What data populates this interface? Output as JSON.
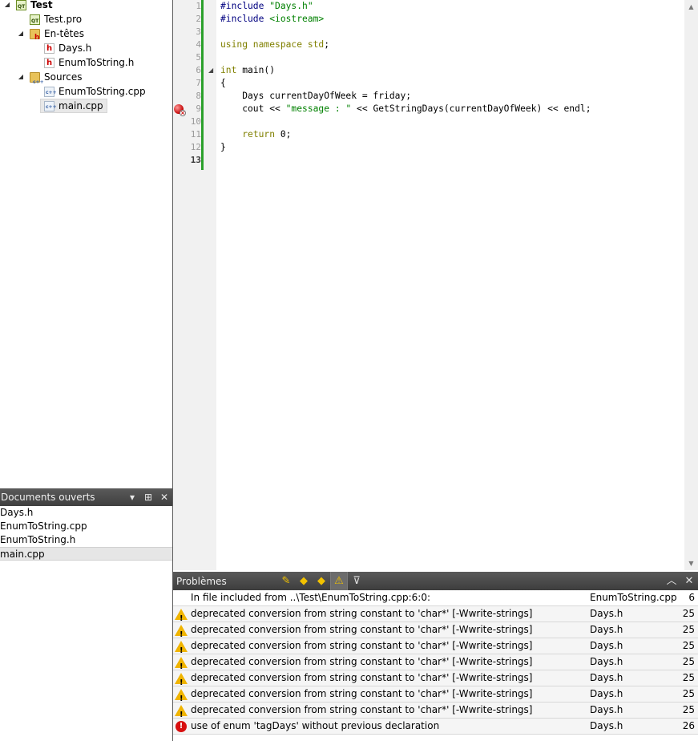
{
  "project_tree": {
    "items": [
      {
        "label": "Test",
        "icon": "project-icon",
        "bold": true,
        "arrow": "expanded"
      },
      {
        "label": "Test.pro",
        "icon": "pro-file-icon"
      },
      {
        "label": "En-têtes",
        "icon": "headers-folder-icon",
        "arrow": "expanded"
      },
      {
        "label": "Days.h",
        "icon": "header-file-icon"
      },
      {
        "label": "EnumToString.h",
        "icon": "header-file-icon"
      },
      {
        "label": "Sources",
        "icon": "sources-folder-icon",
        "arrow": "expanded"
      },
      {
        "label": "EnumToString.cpp",
        "icon": "cpp-file-icon"
      },
      {
        "label": "main.cpp",
        "icon": "cpp-file-icon",
        "selected": true
      }
    ]
  },
  "open_documents": {
    "title": "Documents ouverts",
    "items": [
      "Days.h",
      "EnumToString.cpp",
      "EnumToString.h",
      "main.cpp"
    ],
    "selected_index": 3
  },
  "editor": {
    "current_line": 13,
    "line_numbers": [
      "1",
      "2",
      "3",
      "4",
      "5",
      "6",
      "7",
      "8",
      "9",
      "10",
      "11",
      "12",
      "13"
    ],
    "lines": [
      [
        {
          "t": "pre",
          "s": "#include "
        },
        {
          "t": "str",
          "s": "\"Days.h\""
        }
      ],
      [
        {
          "t": "pre",
          "s": "#include "
        },
        {
          "t": "str",
          "s": "<iostream>"
        }
      ],
      [],
      [
        {
          "t": "kw",
          "s": "using namespace std"
        },
        {
          "t": "plain",
          "s": ";"
        }
      ],
      [],
      [
        {
          "t": "kw",
          "s": "int"
        },
        {
          "t": "plain",
          "s": " main()"
        }
      ],
      [
        {
          "t": "plain",
          "s": "{"
        }
      ],
      [
        {
          "t": "plain",
          "s": "    Days currentDayOfWeek = friday;"
        }
      ],
      [
        {
          "t": "plain",
          "s": "    cout << "
        },
        {
          "t": "str",
          "s": "\"message : \""
        },
        {
          "t": "plain",
          "s": " << GetStringDays(currentDayOfWeek) << endl;"
        }
      ],
      [],
      [
        {
          "t": "plain",
          "s": "    "
        },
        {
          "t": "kw",
          "s": "return"
        },
        {
          "t": "plain",
          "s": " 0;"
        }
      ],
      [
        {
          "t": "plain",
          "s": "}"
        }
      ],
      []
    ]
  },
  "problems": {
    "title": "Problèmes",
    "rows": [
      {
        "type": "info",
        "message": "In file included from ..\\Test\\EnumToString.cpp:6:0:",
        "file": "EnumToString.cpp",
        "line": "6"
      },
      {
        "type": "warning",
        "message": "deprecated conversion from string constant to 'char*' [-Wwrite-strings]",
        "file": "Days.h",
        "line": "25"
      },
      {
        "type": "warning",
        "message": "deprecated conversion from string constant to 'char*' [-Wwrite-strings]",
        "file": "Days.h",
        "line": "25"
      },
      {
        "type": "warning",
        "message": "deprecated conversion from string constant to 'char*' [-Wwrite-strings]",
        "file": "Days.h",
        "line": "25"
      },
      {
        "type": "warning",
        "message": "deprecated conversion from string constant to 'char*' [-Wwrite-strings]",
        "file": "Days.h",
        "line": "25"
      },
      {
        "type": "warning",
        "message": "deprecated conversion from string constant to 'char*' [-Wwrite-strings]",
        "file": "Days.h",
        "line": "25"
      },
      {
        "type": "warning",
        "message": "deprecated conversion from string constant to 'char*' [-Wwrite-strings]",
        "file": "Days.h",
        "line": "25"
      },
      {
        "type": "warning",
        "message": "deprecated conversion from string constant to 'char*' [-Wwrite-strings]",
        "file": "Days.h",
        "line": "25"
      },
      {
        "type": "error",
        "message": "use of enum 'tagDays' without previous declaration",
        "file": "Days.h",
        "line": "26"
      }
    ]
  },
  "colors": {
    "preprocessor": "#000080",
    "string": "#008000",
    "keyword": "#808000",
    "modified_bar": "#2ba02b",
    "warning": "#f0b400",
    "error": "#d81010"
  }
}
